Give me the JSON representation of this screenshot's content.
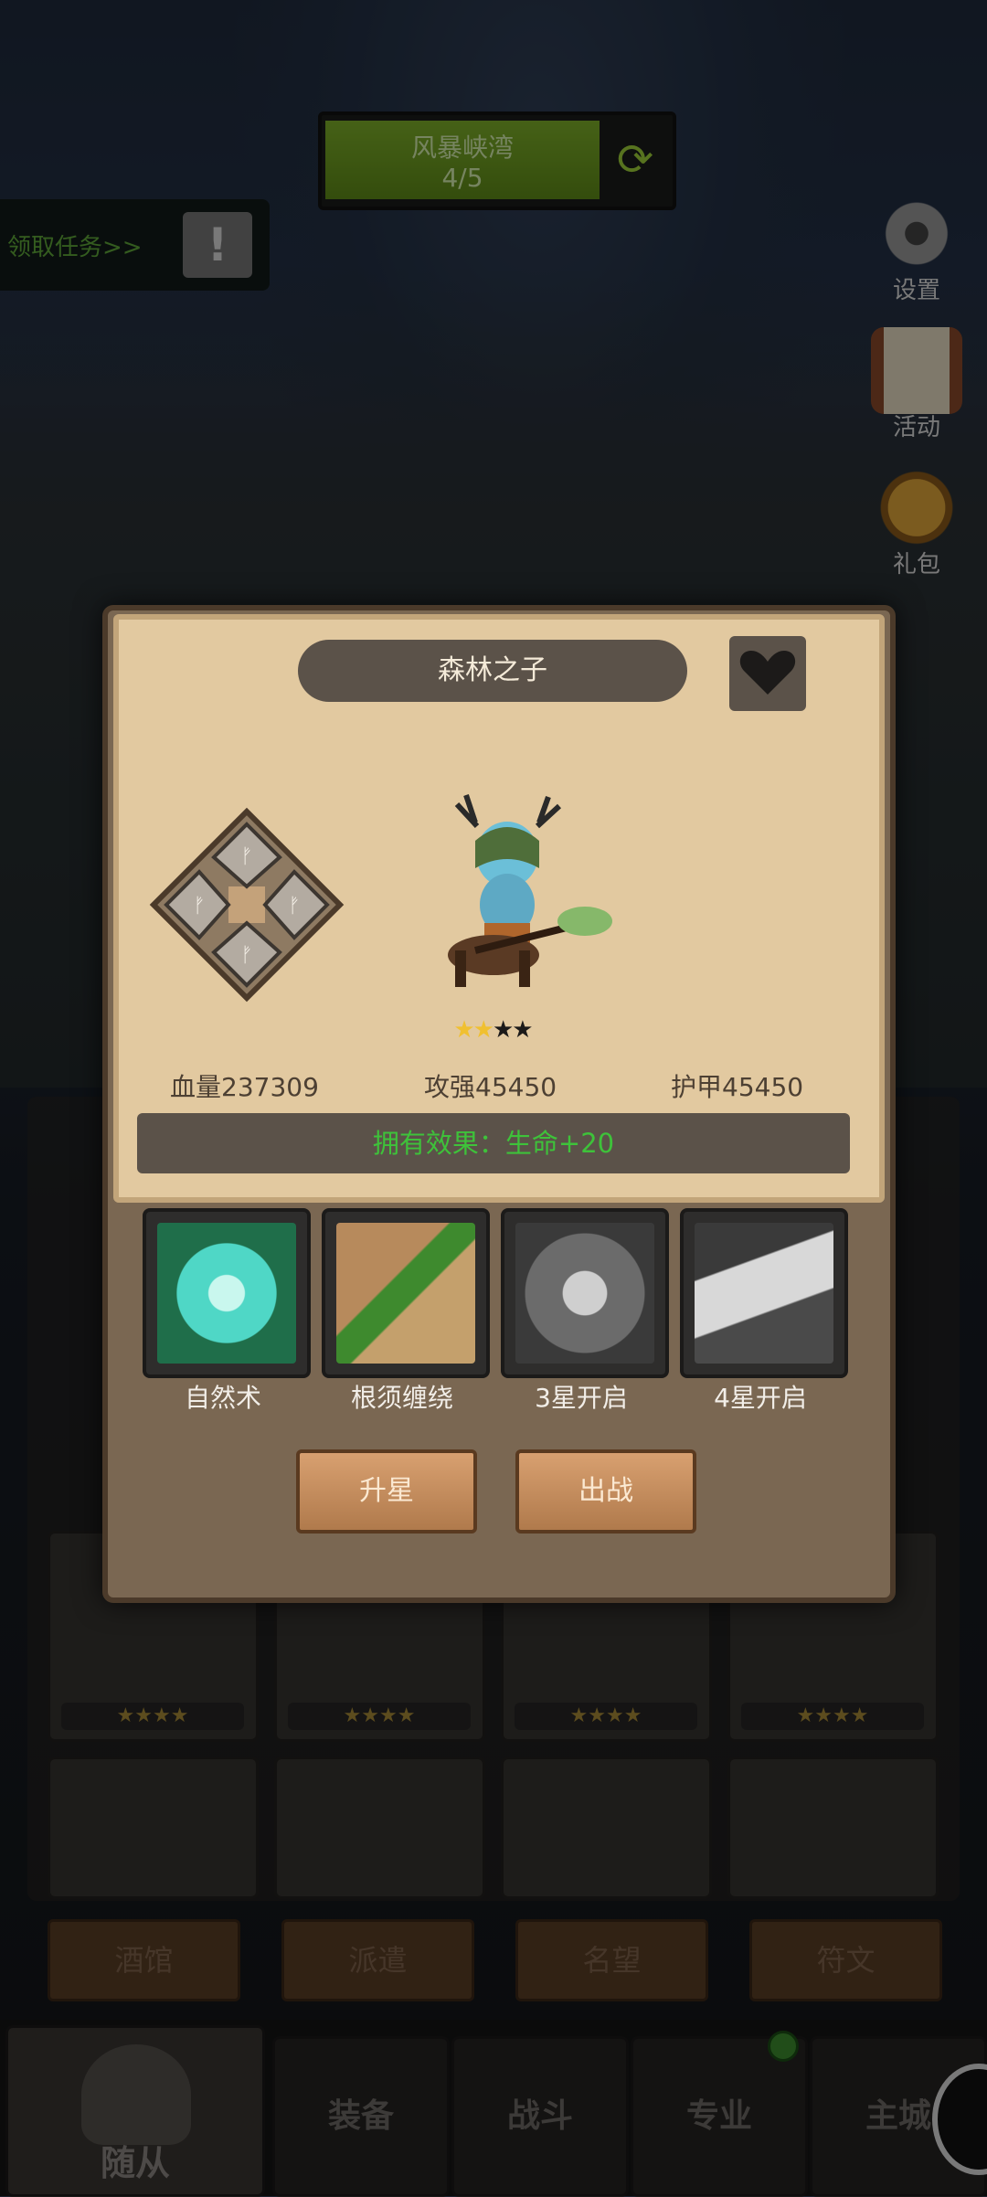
{
  "stage": {
    "name": "风暴峡湾",
    "progress": "4/5"
  },
  "quest": {
    "label": "领取任务>>"
  },
  "side_buttons": [
    {
      "label": "设置",
      "icon": "gear-icon"
    },
    {
      "label": "活动",
      "icon": "scroll-icon"
    },
    {
      "label": "礼包",
      "icon": "gift-pouch-icon"
    }
  ],
  "hero": {
    "name": "森林之子",
    "stars_filled": 2,
    "stars_total": 4,
    "stats": {
      "hp": "血量237309",
      "attack": "攻强45450",
      "armor": "护甲45450"
    },
    "effect": "拥有效果：生命+20"
  },
  "skills": [
    {
      "label": "自然术",
      "locked": false
    },
    {
      "label": "根须缠绕",
      "locked": false
    },
    {
      "label": "3星开启",
      "locked": true
    },
    {
      "label": "4星开启",
      "locked": true
    }
  ],
  "actions": {
    "upgrade": "升星",
    "deploy": "出战"
  },
  "tabs": [
    "酒馆",
    "派遣",
    "名望",
    "符文"
  ],
  "nav": {
    "follower": "随从",
    "equipment": "装备",
    "battle": "战斗",
    "profession": "专业",
    "city": "主城"
  },
  "colors": {
    "effect_green": "#3ec23a",
    "stage_green": "#7fb12a",
    "star_gold": "#f0c030"
  }
}
